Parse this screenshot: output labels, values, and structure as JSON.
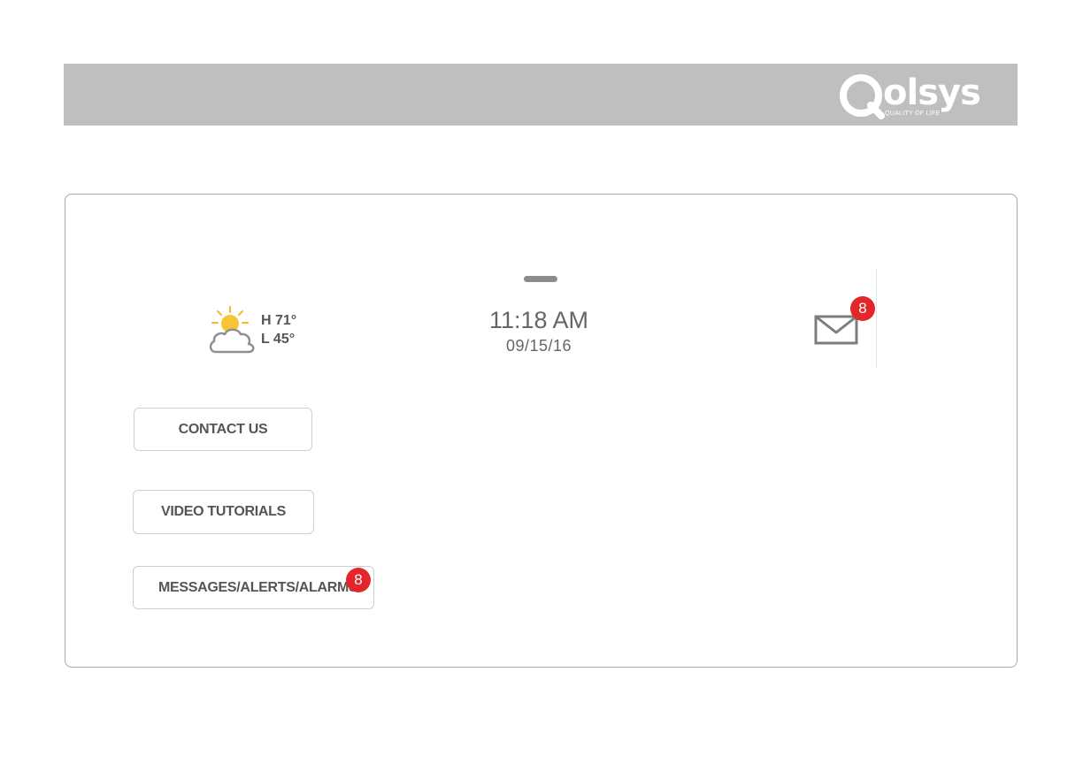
{
  "header": {
    "logo": {
      "word": "olsys",
      "tagline": "QUALITY OF LIFE"
    }
  },
  "status": {
    "weather": {
      "icon": "partly-cloudy-icon",
      "high": "H 71°",
      "low": "L 45°"
    },
    "time": "11:18 AM",
    "date": "09/15/16",
    "messages": {
      "icon": "envelope-icon",
      "count": "8"
    }
  },
  "menu": {
    "contact_us": "CONTACT US",
    "video_tutorials": "VIDEO TUTORIALS",
    "messages_alerts_alarms": "MESSAGES/ALERTS/ALARMS",
    "messages_badge": "8"
  },
  "colors": {
    "header_bg": "#bfbfbf",
    "badge_red": "#e3262a",
    "text_gray": "#555555"
  }
}
